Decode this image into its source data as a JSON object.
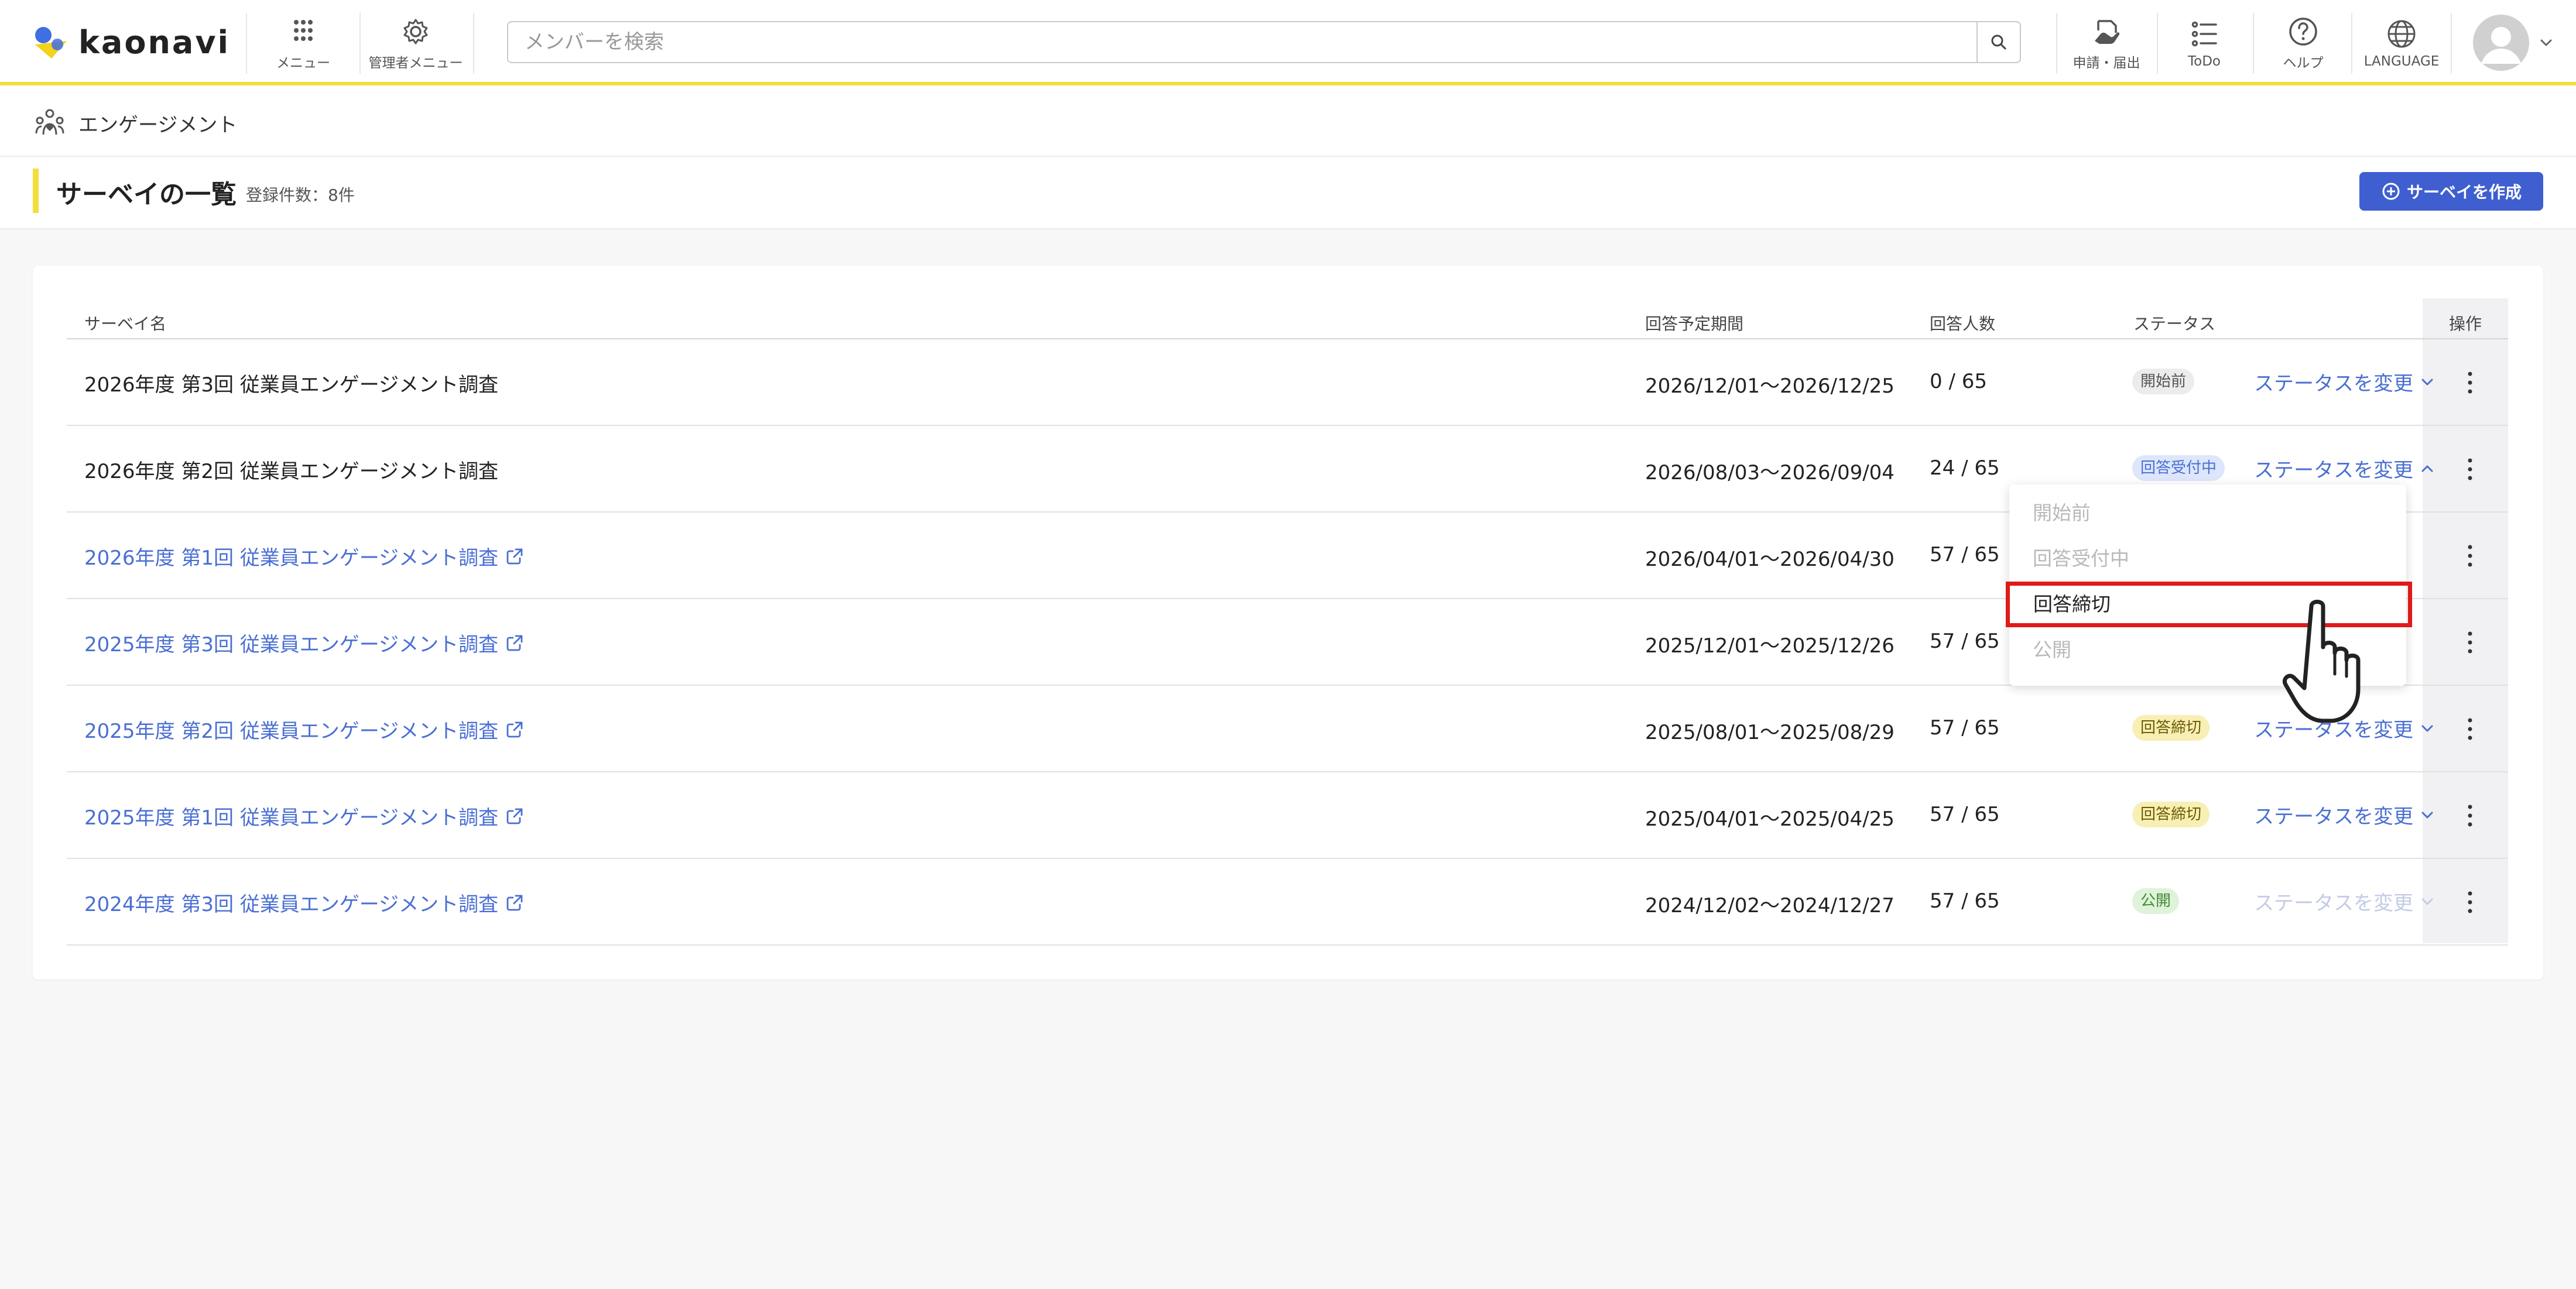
{
  "header": {
    "logo_text": "kaonavi",
    "menu_label": "メニュー",
    "admin_menu_label": "管理者メニュー",
    "search_placeholder": "メンバーを検索",
    "apply_label": "申請・届出",
    "todo_label": "ToDo",
    "help_label": "ヘルプ",
    "language_label": "LANGUAGE"
  },
  "breadcrumb": {
    "label": "エンゲージメント"
  },
  "page": {
    "title": "サーベイの一覧",
    "count_label": "登録件数：8件",
    "create_button": "サーベイを作成"
  },
  "table": {
    "columns": [
      "サーベイ名",
      "回答予定期間",
      "回答人数",
      "ステータス",
      "操作"
    ],
    "change_label": "ステータスを変更",
    "rows": [
      {
        "name": "2026年度 第3回 従業員エンゲージメント調査",
        "period": "2026/12/01〜2026/12/25",
        "count": "0 / 65",
        "status": "開始前"
      },
      {
        "name": "2026年度 第2回 従業員エンゲージメント調査",
        "period": "2026/08/03〜2026/09/04",
        "count": "24 / 65",
        "status": "回答受付中"
      },
      {
        "name": "2026年度 第1回 従業員エンゲージメント調査",
        "period": "2026/04/01〜2026/04/30",
        "count": "57 / 65",
        "status": ""
      },
      {
        "name": "2025年度 第3回 従業員エンゲージメント調査",
        "period": "2025/12/01〜2025/12/26",
        "count": "57 / 65",
        "status": ""
      },
      {
        "name": "2025年度 第2回 従業員エンゲージメント調査",
        "period": "2025/08/01〜2025/08/29",
        "count": "57 / 65",
        "status": "回答締切"
      },
      {
        "name": "2025年度 第1回 従業員エンゲージメント調査",
        "period": "2025/04/01〜2025/04/25",
        "count": "57 / 65",
        "status": "回答締切"
      },
      {
        "name": "2024年度 第3回 従業員エンゲージメント調査",
        "period": "2024/12/02〜2024/12/27",
        "count": "57 / 65",
        "status": "公開"
      }
    ]
  },
  "dropdown": {
    "items": [
      "開始前",
      "回答受付中",
      "回答締切",
      "公開"
    ],
    "selected": "回答締切"
  },
  "colors": {
    "accent_yellow": "#f2df3a",
    "primary_blue": "#3f5fd0",
    "link_blue": "#4a6fd3",
    "highlight_red": "#e01919"
  }
}
